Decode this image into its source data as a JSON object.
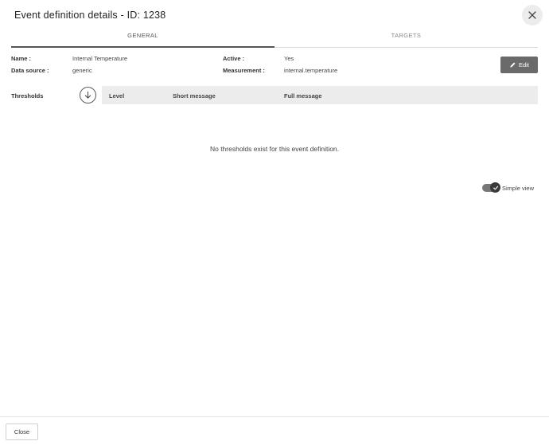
{
  "dialog": {
    "title": "Event definition details - ID: 1238"
  },
  "tabs": [
    {
      "label": "GENERAL",
      "active": true
    },
    {
      "label": "TARGETS",
      "active": false
    }
  ],
  "details": {
    "name_label": "Name :",
    "name_value": "Internal Temperature",
    "source_label": "Data source :",
    "source_value": "generic",
    "active_label": "Active :",
    "active_value": "Yes",
    "measurement_label": "Measurement :",
    "measurement_value": "internal.temperature"
  },
  "edit_button": {
    "label": "Edit",
    "icon": "pencil-icon"
  },
  "thresholds": {
    "label": "Thresholds",
    "sort_icon": "arrow-down-circle-icon",
    "columns": [
      "Level",
      "Short message",
      "Full message"
    ],
    "empty_message": "No thresholds exist for this event definition."
  },
  "simple_view": {
    "label": "Simple view",
    "enabled": true
  },
  "footer": {
    "close_label": "Close"
  },
  "colors": {
    "edit_button_bg": "#6a6a6a",
    "table_header_bg": "#ececec",
    "toggle_track": "#777777",
    "toggle_knob": "#3a3a3a"
  }
}
